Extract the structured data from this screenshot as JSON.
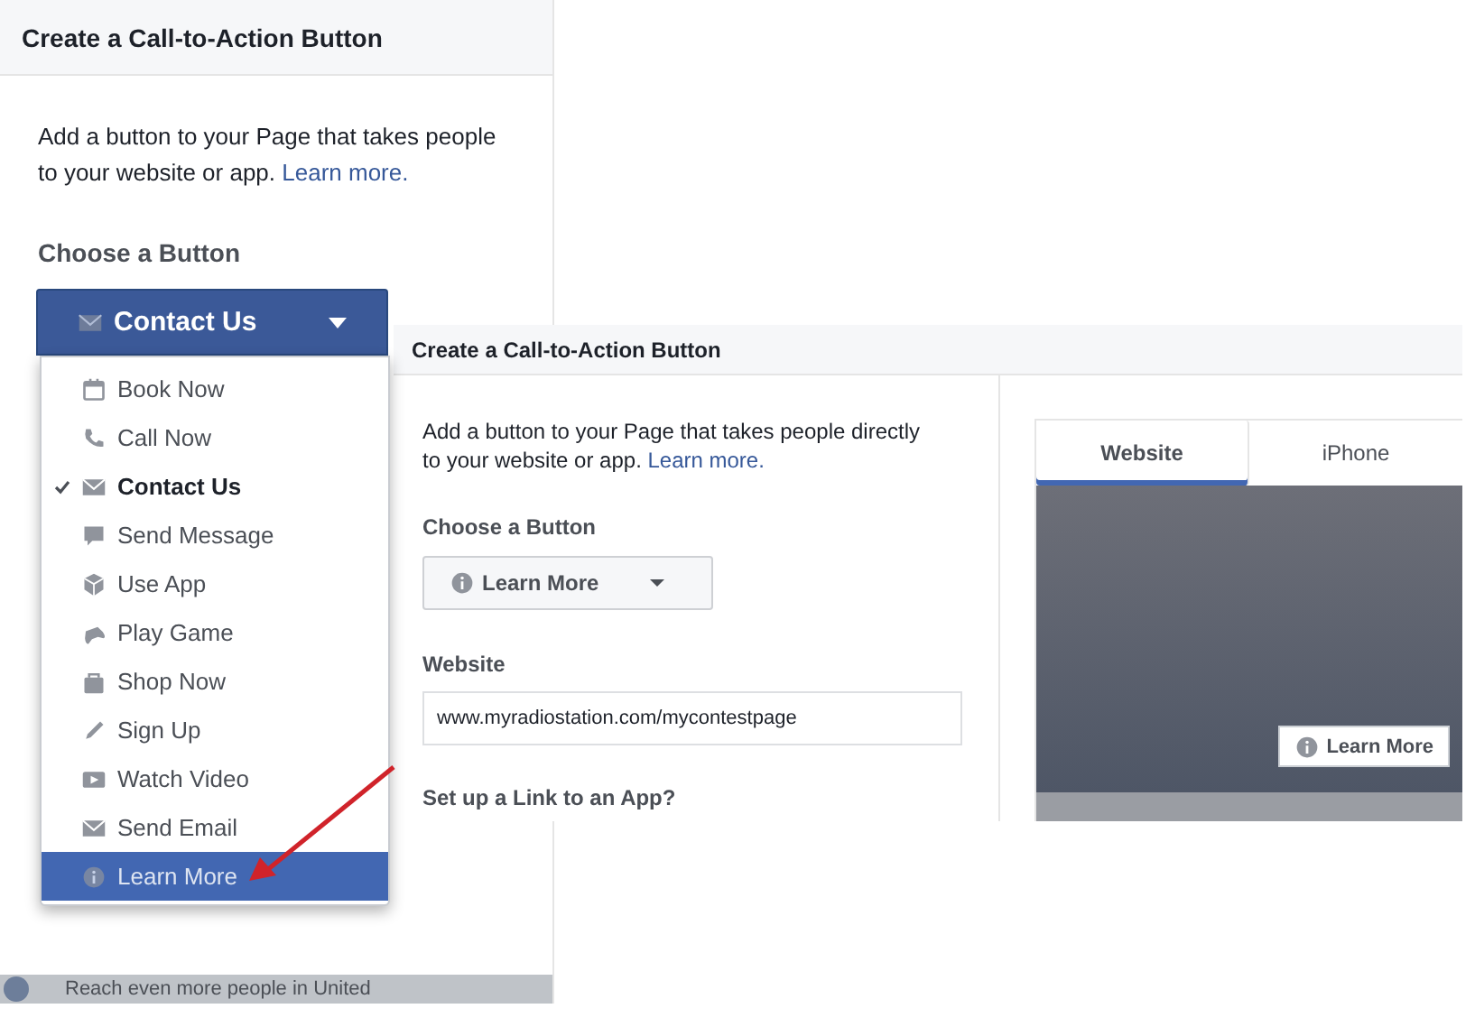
{
  "back_dialog": {
    "title": "Create a Call-to-Action Button",
    "intro_lines": [
      "Add a button to your Page that takes people",
      "to your website or app."
    ],
    "link": "Learn more.",
    "choose_label": "Choose a Button",
    "button": {
      "label": "Contact Us",
      "expanded": true
    },
    "footer": "Reach even more people in United"
  },
  "menu": [
    {
      "label": "Book Now",
      "checked": false,
      "selected": false
    },
    {
      "label": "Call Now",
      "checked": false,
      "selected": false
    },
    {
      "label": "Contact Us",
      "checked": true,
      "selected": false
    },
    {
      "label": "Send Message",
      "checked": false,
      "selected": false
    },
    {
      "label": "Use App",
      "checked": false,
      "selected": false
    },
    {
      "label": "Play Game",
      "checked": false,
      "selected": false
    },
    {
      "label": "Shop Now",
      "checked": false,
      "selected": false
    },
    {
      "label": "Sign Up",
      "checked": false,
      "selected": false
    },
    {
      "label": "Watch Video",
      "checked": false,
      "selected": false
    },
    {
      "label": "Send Email",
      "checked": false,
      "selected": false
    },
    {
      "label": "Learn More",
      "checked": false,
      "selected": true
    }
  ],
  "front_dialog": {
    "title": "Create a Call-to-Action Button",
    "intro_lines": [
      "Add a button to your Page that takes people directly",
      "to your website or app."
    ],
    "link": "Learn more.",
    "choose_label": "Choose a Button",
    "button": {
      "label": "Learn More"
    },
    "website_label": "Website",
    "website_value": "www.myradiostation.com/mycontestpage",
    "app_label": "Set up a Link to an App?",
    "preview_tabs": [
      {
        "label": "Website",
        "selected": true
      },
      {
        "label": "iPhone",
        "selected": false
      }
    ],
    "preview_button": "Learn More"
  }
}
